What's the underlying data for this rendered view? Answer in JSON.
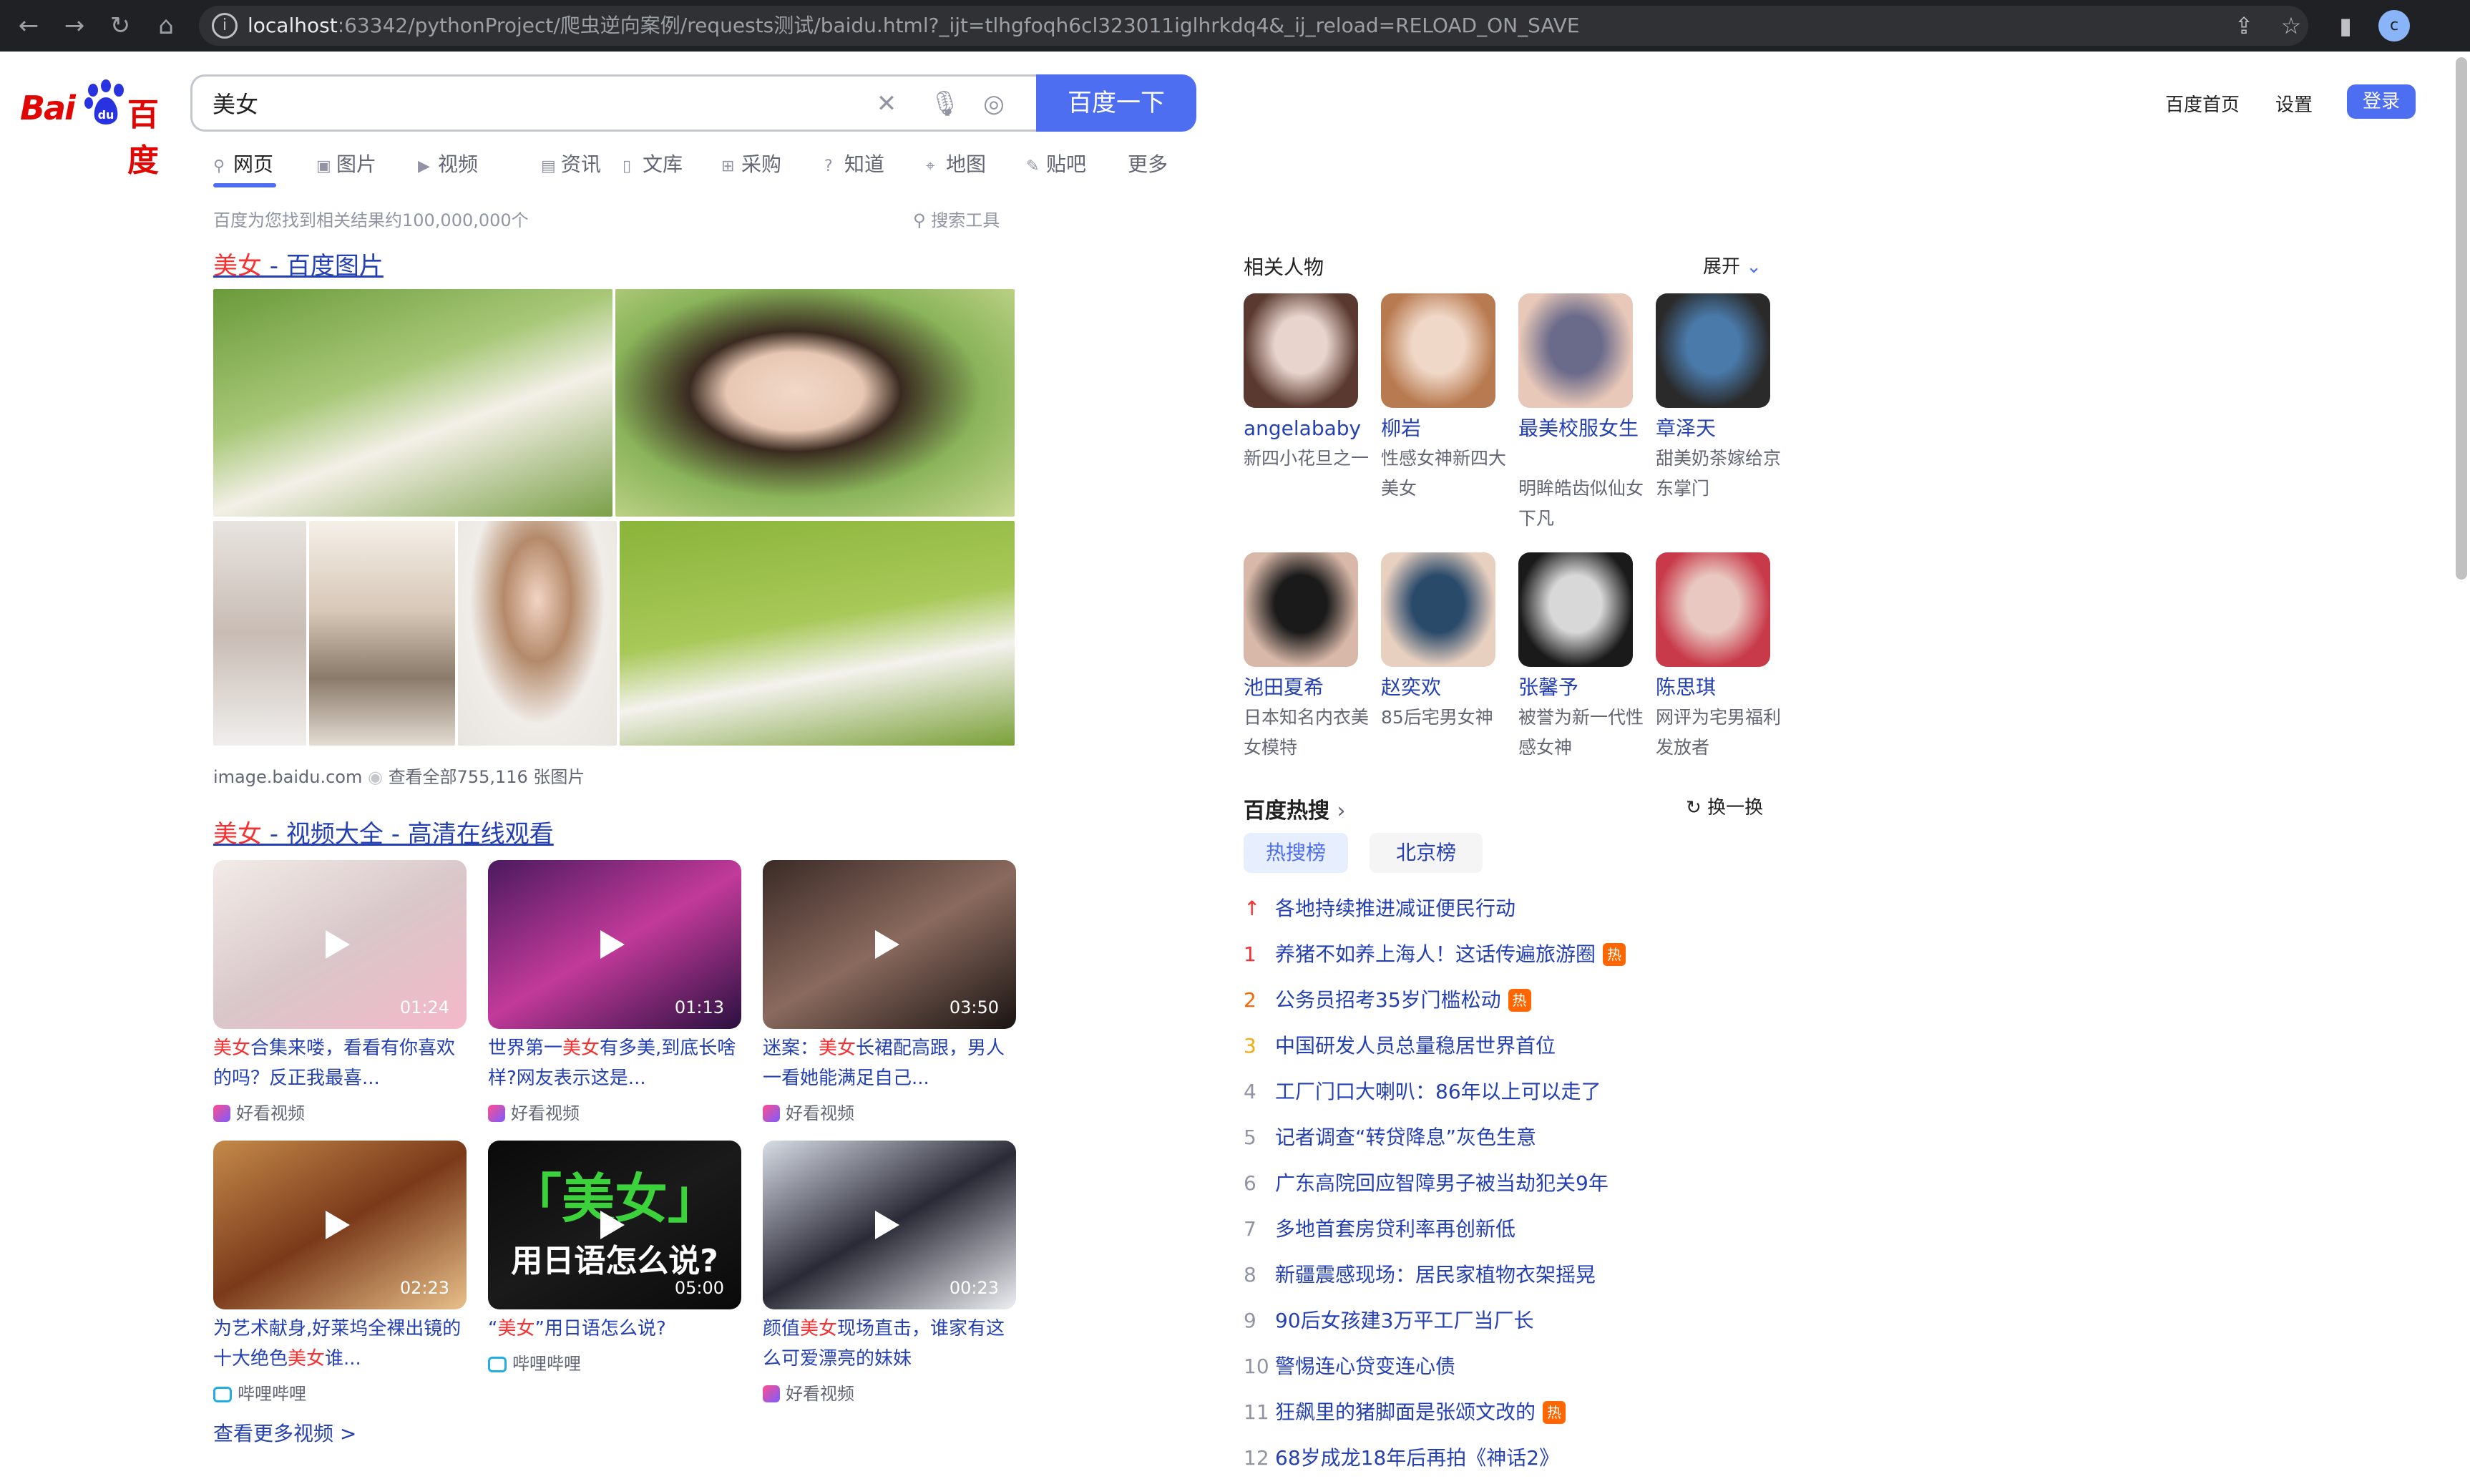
{
  "browser": {
    "url_host": "localhost",
    "url_rest": ":63342/pythonProject/爬虫逆向案例/requests测试/baidu.html?_ijt=tlhgfoqh6cl323011iglhrkdq4&_ij_reload=RELOAD_ON_SAVE",
    "avatar_letter": "c"
  },
  "logo": {
    "bai": "Bai",
    "du": "百度"
  },
  "search": {
    "query": "美女",
    "button": "百度一下"
  },
  "header": {
    "home": "百度首页",
    "settings": "设置",
    "login": "登录"
  },
  "tabs": [
    {
      "label": "网页",
      "icon": "search-icon"
    },
    {
      "label": "图片",
      "icon": "image-icon"
    },
    {
      "label": "视频",
      "icon": "video-icon"
    },
    {
      "label": "资讯",
      "icon": "news-icon"
    },
    {
      "label": "文库",
      "icon": "document-icon"
    },
    {
      "label": "采购",
      "icon": "shopping-icon"
    },
    {
      "label": "知道",
      "icon": "question-icon"
    },
    {
      "label": "地图",
      "icon": "map-icon"
    },
    {
      "label": "贴吧",
      "icon": "tieba-icon"
    },
    {
      "label": "更多",
      "icon": ""
    }
  ],
  "results": {
    "count_text": "百度为您找到相关结果约100,000,000个",
    "tools": "搜索工具",
    "image_result": {
      "em": "美女",
      "title_rest": " - 百度图片",
      "source": "image.baidu.com",
      "view_all": "查看全部755,116 张图片"
    },
    "video_result": {
      "em": "美女",
      "title_rest": " - 视频大全 - 高清在线观看"
    },
    "videos": [
      {
        "duration": "01:24",
        "em": "美女",
        "pre": "",
        "text": "合集来喽，看看有你喜欢的吗？反正我最喜...",
        "source": "好看视频",
        "src_icon": "haokan-icon",
        "colors": [
          "#f2ece8",
          "#d9c7c9",
          "#f4b8c8"
        ]
      },
      {
        "duration": "01:13",
        "pre": "世界第一",
        "em": "美女",
        "text": "有多美,到底长啥样?网友表示这是...",
        "source": "好看视频",
        "src_icon": "haokan-icon",
        "colors": [
          "#4a1a5e",
          "#c23a9a",
          "#2a1040"
        ]
      },
      {
        "duration": "03:50",
        "pre": "迷案：",
        "em": "美女",
        "text": "长裙配高跟，男人一看她能满足自己...",
        "source": "好看视频",
        "src_icon": "haokan-icon",
        "colors": [
          "#3a2a26",
          "#8a6a5e",
          "#1a1412"
        ]
      },
      {
        "duration": "02:23",
        "pre": "为艺术献身,好莱坞全裸出镜的十大绝色",
        "em": "美女",
        "text": "谁...",
        "source": "哔哩哔哩",
        "src_icon": "bilibili-icon",
        "colors": [
          "#c48a4a",
          "#7a3a1a",
          "#e8c08a"
        ]
      },
      {
        "duration": "05:00",
        "pre": "“",
        "em": "美女",
        "text": "”用日语怎么说?",
        "source": "哔哩哔哩",
        "src_icon": "bilibili-icon",
        "colors": [
          "#0a0a0a",
          "#1a1a1a",
          "#0a0a0a"
        ],
        "overlay1": "「美女」",
        "overlay2": "用日语怎么说?"
      },
      {
        "duration": "00:23",
        "pre": "颜值",
        "em": "美女",
        "text": "现场直击，谁家有这么可爱漂亮的妹妹",
        "source": "好看视频",
        "src_icon": "haokan-icon",
        "colors": [
          "#d8dde6",
          "#2a2a36",
          "#eef0f4"
        ]
      }
    ],
    "more_videos": "查看更多视频 >"
  },
  "related": {
    "title": "相关人物",
    "expand": "展开",
    "people": [
      {
        "name": "angelababy",
        "desc": "新四小花旦之一",
        "colors": [
          "#e8d4cc",
          "#5a3a30"
        ]
      },
      {
        "name": "柳岩",
        "desc": "性感女神新四大美女",
        "colors": [
          "#f0d8c8",
          "#b87a50"
        ]
      },
      {
        "name": "最美校服女生",
        "desc": "明眸皓齿似仙女下凡",
        "colors": [
          "#6a6a8a",
          "#e8c8b8"
        ]
      },
      {
        "name": "章泽天",
        "desc": "甜美奶茶嫁给京东掌门",
        "colors": [
          "#4a7aaa",
          "#2a2a2a"
        ]
      },
      {
        "name": "池田夏希",
        "desc": "日本知名内衣美女模特",
        "colors": [
          "#1a1a1a",
          "#d8b8a8"
        ]
      },
      {
        "name": "赵奕欢",
        "desc": "85后宅男女神",
        "colors": [
          "#2a4a6a",
          "#e8d0c0"
        ]
      },
      {
        "name": "张馨予",
        "desc": "被誉为新一代性感女神",
        "colors": [
          "#d8d8d8",
          "#1a1a1a"
        ]
      },
      {
        "name": "陈思琪",
        "desc": "网评为宅男福利发放者",
        "colors": [
          "#e8c8c0",
          "#c83a4a"
        ]
      }
    ]
  },
  "hot": {
    "title": "百度热搜",
    "refresh": "换一换",
    "tabs": [
      "热搜榜",
      "北京榜"
    ],
    "items": [
      {
        "num": "↑",
        "text": "各地持续推进减证便民行动",
        "badge": "",
        "numcolor": "#f73131"
      },
      {
        "num": "1",
        "text": "养猪不如养上海人！这话传遍旅游圈",
        "badge": "热",
        "numcolor": "#f73131"
      },
      {
        "num": "2",
        "text": "公务员招考35岁门槛松动",
        "badge": "热",
        "numcolor": "#ff6600"
      },
      {
        "num": "3",
        "text": "中国研发人员总量稳居世界首位",
        "badge": "",
        "numcolor": "#faa90e"
      },
      {
        "num": "4",
        "text": "工厂门口大喇叭：86年以上可以走了",
        "badge": "",
        "numcolor": "#9195a3"
      },
      {
        "num": "5",
        "text": "记者调查“转贷降息”灰色生意",
        "badge": "",
        "numcolor": "#9195a3"
      },
      {
        "num": "6",
        "text": "广东高院回应智障男子被当劫犯关9年",
        "badge": "",
        "numcolor": "#9195a3"
      },
      {
        "num": "7",
        "text": "多地首套房贷利率再创新低",
        "badge": "",
        "numcolor": "#9195a3"
      },
      {
        "num": "8",
        "text": "新疆震感现场：居民家植物衣架摇晃",
        "badge": "",
        "numcolor": "#9195a3"
      },
      {
        "num": "9",
        "text": "90后女孩建3万平工厂当厂长",
        "badge": "",
        "numcolor": "#9195a3"
      },
      {
        "num": "10",
        "text": "警惕连心贷变连心债",
        "badge": "",
        "numcolor": "#9195a3"
      },
      {
        "num": "11",
        "text": "狂飙里的猪脚面是张颂文改的",
        "badge": "热",
        "numcolor": "#9195a3"
      },
      {
        "num": "12",
        "text": "68岁成龙18年后再拍《神话2》",
        "badge": "",
        "numcolor": "#9195a3"
      }
    ]
  },
  "colors": {
    "accent": "#4e6ef2",
    "link": "#2440b3",
    "highlight": "#f73131",
    "hot_badge": "#ff6600"
  }
}
